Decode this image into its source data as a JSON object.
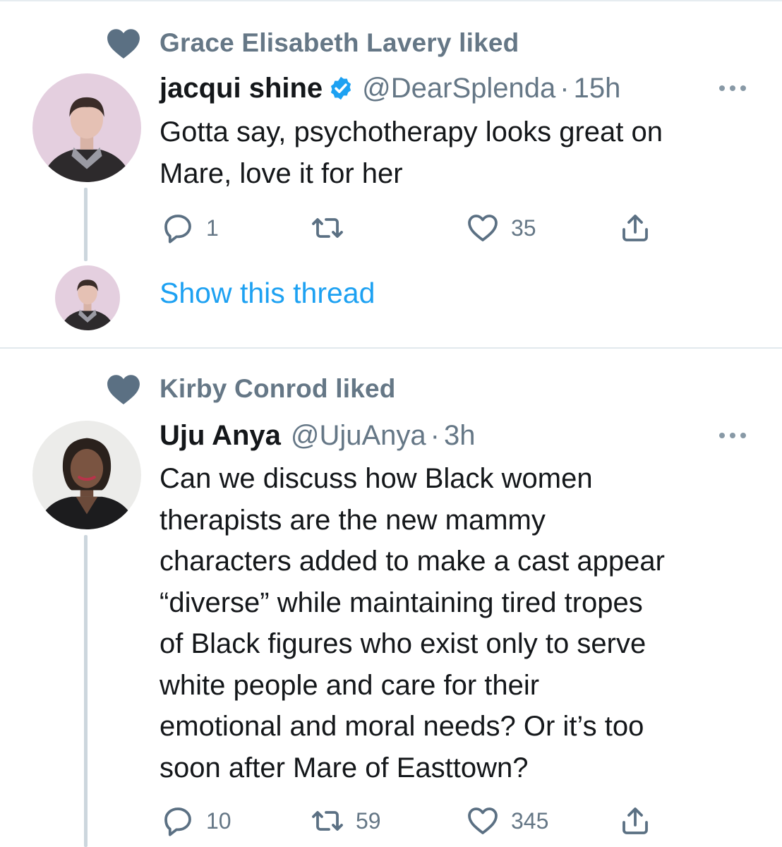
{
  "tweets": [
    {
      "social_context": "Grace Elisabeth Lavery liked",
      "display_name": "jacqui shine",
      "verified": true,
      "handle": "@DearSplenda",
      "separator": "·",
      "time": "15h",
      "text": "Gotta say, psychotherapy looks great on\nMare, love it for her",
      "reply_count": "1",
      "retweet_count": "",
      "like_count": "35",
      "show_thread_label": "Show this thread"
    },
    {
      "social_context": "Kirby Conrod liked",
      "display_name": "Uju Anya",
      "verified": false,
      "handle": "@UjuAnya",
      "separator": "·",
      "time": "3h",
      "text": "Can we discuss how Black women\ntherapists are the new mammy\ncharacters added to make a cast appear\n“diverse” while maintaining tired tropes\nof Black figures who exist only to serve\nwhite people and care for their\nemotional and moral needs? Or it’s too\nsoon after Mare of Easttown?",
      "reply_count": "10",
      "retweet_count": "59",
      "like_count": "345"
    }
  ],
  "icons": {
    "social_context": "heart-icon",
    "verified": "verified-badge-icon",
    "more": "more-options-icon",
    "reply": "reply-icon",
    "retweet": "retweet-icon",
    "like": "like-icon",
    "share": "share-icon"
  },
  "colors": {
    "accent": "#1da1f2",
    "secondary_text": "#657786",
    "primary_text": "#14171a",
    "icon_gray": "#5b7083",
    "thread_line": "#ccd6dd",
    "divider": "#e1e8ed"
  }
}
